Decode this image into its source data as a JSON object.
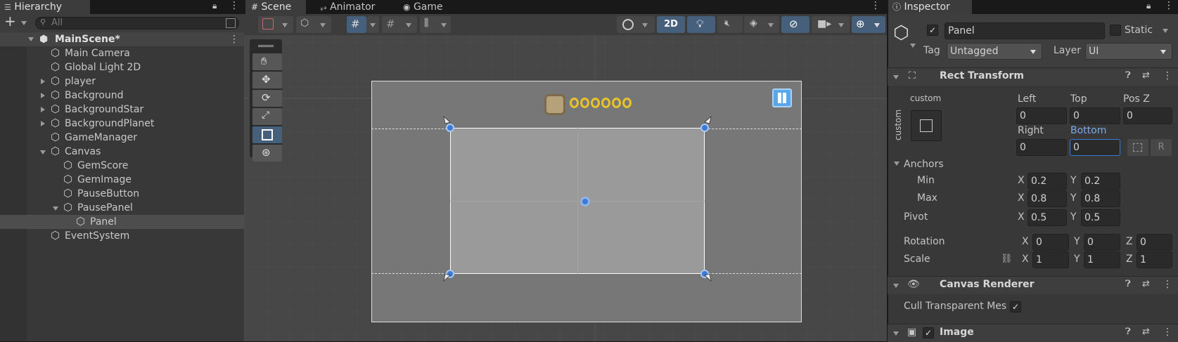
{
  "hierarchy": {
    "tab": "Hierarchy",
    "search_placeholder": "All",
    "add_label": "+",
    "items": [
      {
        "label": "MainScene*"
      },
      {
        "label": "Main Camera"
      },
      {
        "label": "Global Light 2D"
      },
      {
        "label": "player"
      },
      {
        "label": "Background"
      },
      {
        "label": "BackgroundStar"
      },
      {
        "label": "BackgroundPlanet"
      },
      {
        "label": "GameManager"
      },
      {
        "label": "Canvas"
      },
      {
        "label": "GemScore"
      },
      {
        "label": "GemImage"
      },
      {
        "label": "PauseButton"
      },
      {
        "label": "PausePanel"
      },
      {
        "label": "Panel"
      },
      {
        "label": "EventSystem"
      }
    ]
  },
  "scene": {
    "tabs": [
      {
        "label": "Scene"
      },
      {
        "label": "Animator"
      },
      {
        "label": "Game"
      }
    ],
    "mode_2d": "2D"
  },
  "inspector": {
    "tab": "Inspector",
    "object_name": "Panel",
    "static_label": "Static",
    "tag_label": "Tag",
    "tag_value": "Untagged",
    "layer_label": "Layer",
    "layer_value": "UI",
    "rect": {
      "title": "Rect Transform",
      "anchor_preset": "custom",
      "side_label": "custom",
      "left_label": "Left",
      "top_label": "Top",
      "posz_label": "Pos Z",
      "left": "0",
      "top": "0",
      "posz": "0",
      "right_label": "Right",
      "bottom_label": "Bottom",
      "right": "0",
      "bottom": "0",
      "r_button": "R",
      "anchors_label": "Anchors",
      "min_label": "Min",
      "max_label": "Max",
      "pivot_label": "Pivot",
      "min_x": "0.2",
      "min_y": "0.2",
      "max_x": "0.8",
      "max_y": "0.8",
      "pivot_x": "0.5",
      "pivot_y": "0.5",
      "rotation_label": "Rotation",
      "rot_x": "0",
      "rot_y": "0",
      "rot_z": "0",
      "scale_label": "Scale",
      "scale_x": "1",
      "scale_y": "1",
      "scale_z": "1",
      "x": "X",
      "y": "Y",
      "z": "Z"
    },
    "canvas_renderer": {
      "title": "Canvas Renderer",
      "cull_label": "Cull Transparent Mes"
    },
    "image": {
      "title": "Image"
    }
  },
  "colors": {
    "accent": "#3c7ad6",
    "selected_tool": "#46607c",
    "bottom_label": "#7aa9e8"
  }
}
